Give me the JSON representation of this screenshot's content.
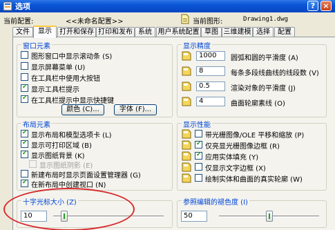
{
  "window": {
    "title": "选项",
    "help_label": "?",
    "close_label": "×"
  },
  "config": {
    "current_config_label": "当前配置:",
    "current_config_value": "<<未命名配置>>",
    "current_drawing_label": "当前图形:",
    "current_drawing_value": "Drawing1.dwg"
  },
  "tabs": [
    {
      "label": "文件"
    },
    {
      "label": "显示"
    },
    {
      "label": "打开和保存"
    },
    {
      "label": "打印和发布"
    },
    {
      "label": "系统"
    },
    {
      "label": "用户系统配置"
    },
    {
      "label": "草图"
    },
    {
      "label": "三维建模"
    },
    {
      "label": "选择"
    },
    {
      "label": "配置"
    }
  ],
  "active_tab": "显示",
  "window_elements": {
    "title": "窗口元素",
    "items": [
      {
        "label": "图形窗口中显示滚动条 (S)",
        "checked": false
      },
      {
        "label": "显示屏幕菜单 (U)",
        "checked": false
      },
      {
        "label": "在工具栏中使用大按钮",
        "checked": false
      },
      {
        "label": "显示工具栏提示",
        "checked": true
      },
      {
        "label": "在工具栏提示中显示快捷键",
        "checked": true
      }
    ],
    "colors_button": "颜色 (C)...",
    "fonts_button": "字体 (F)..."
  },
  "display_resolution": {
    "title": "显示精度",
    "items": [
      {
        "value": "1000",
        "label": "圆弧和圆的平滑度 (A)"
      },
      {
        "value": "8",
        "label": "每条多段线曲线的线段数 (V)"
      },
      {
        "value": "0.5",
        "label": "渲染对象的平滑度 (J)"
      },
      {
        "value": "4",
        "label": "曲面轮廓素线 (O)"
      }
    ]
  },
  "layout_elements": {
    "title": "布局元素",
    "items": [
      {
        "label": "显示布局和模型选项卡 (L)",
        "checked": true,
        "disabled": false
      },
      {
        "label": "显示可打印区域 (B)",
        "checked": true,
        "disabled": false
      },
      {
        "label": "显示图纸背景 (K)",
        "checked": true,
        "disabled": false
      },
      {
        "label": "显示图纸阴影 (E)",
        "checked": false,
        "disabled": true
      },
      {
        "label": "新建布局时显示页面设置管理器 (G)",
        "checked": false,
        "disabled": false
      },
      {
        "label": "在新布局中创建视口 (N)",
        "checked": true,
        "disabled": false
      }
    ]
  },
  "display_performance": {
    "title": "显示性能",
    "items": [
      {
        "label": "带光栅图像/OLE 平移和缩放 (P)",
        "checked": false
      },
      {
        "label": "仅亮显光栅图像边框 (R)",
        "checked": true
      },
      {
        "label": "应用实体填充 (Y)",
        "checked": true
      },
      {
        "label": "仅显示文字边框 (X)",
        "checked": false
      },
      {
        "label": "绘制实体和曲面的真实轮廓 (W)",
        "checked": false
      }
    ]
  },
  "crosshair": {
    "title": "十字光标大小 (Z)",
    "value": "10",
    "fraction": 0.1
  },
  "xref_fade": {
    "title": "参照编辑的褪色度 (I)",
    "value": "50",
    "fraction": 0.5
  },
  "colors": {
    "accent": "#0046d5",
    "check": "#21a121",
    "annotation": "#d8282b",
    "titlebar": "#0a55d6"
  }
}
